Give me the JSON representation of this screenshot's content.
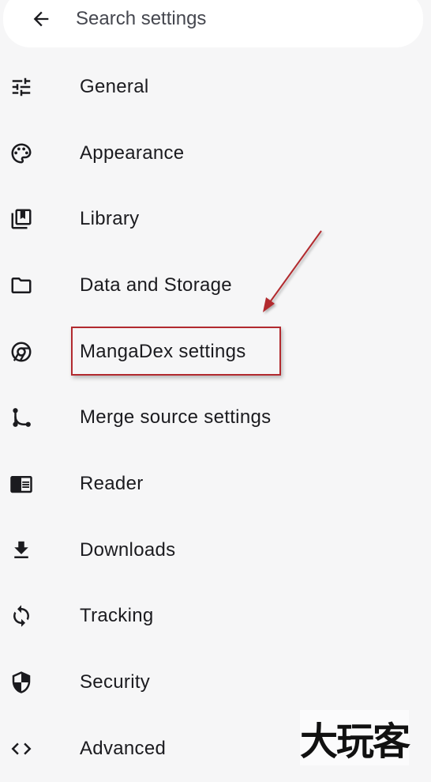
{
  "search": {
    "placeholder": "Search settings",
    "back_icon": "arrow-back-icon"
  },
  "menu": {
    "items": [
      {
        "label": "General",
        "icon": "tune-icon"
      },
      {
        "label": "Appearance",
        "icon": "palette-icon"
      },
      {
        "label": "Library",
        "icon": "collections-bookmark-icon"
      },
      {
        "label": "Data and Storage",
        "icon": "folder-icon"
      },
      {
        "label": "MangaDex settings",
        "icon": "chrome-reader-icon"
      },
      {
        "label": "Merge source settings",
        "icon": "merge-icon"
      },
      {
        "label": "Reader",
        "icon": "chrome-reader-mode-icon"
      },
      {
        "label": "Downloads",
        "icon": "download-icon"
      },
      {
        "label": "Tracking",
        "icon": "sync-icon"
      },
      {
        "label": "Security",
        "icon": "shield-icon"
      },
      {
        "label": "Advanced",
        "icon": "code-icon"
      }
    ]
  },
  "annotation": {
    "highlight_color": "#b22a2f",
    "highlighted_item": "MangaDex settings"
  },
  "watermark": {
    "text": "大玩客"
  },
  "colors": {
    "background": "#f6f6f7",
    "text": "#1b1b1f",
    "search_background": "#ffffff"
  }
}
